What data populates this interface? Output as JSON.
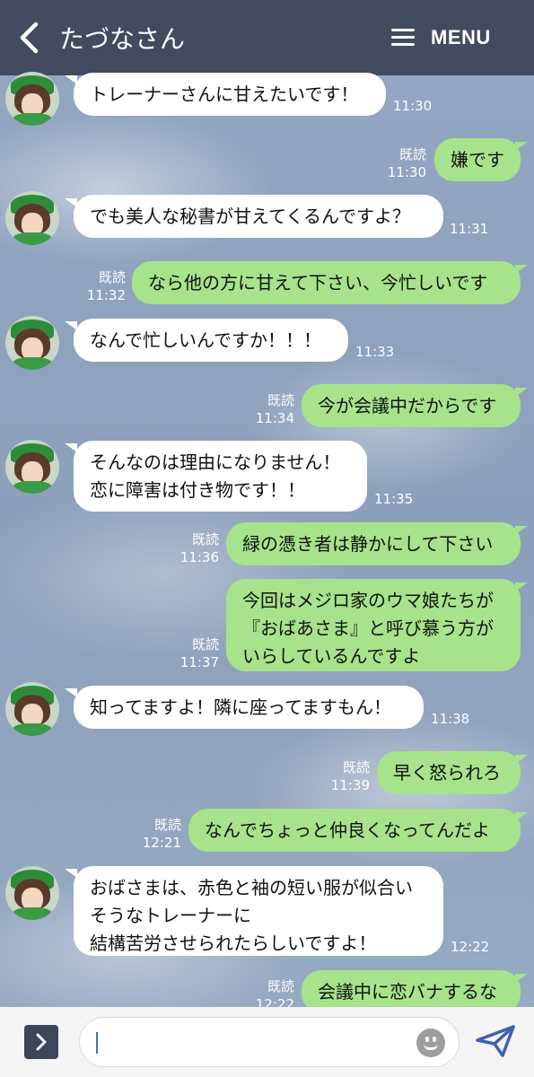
{
  "header": {
    "title": "たづなさん",
    "menu_label": "MENU"
  },
  "messages": [
    {
      "side": "left",
      "text": "トレーナーさんに甘えたいです！",
      "time": "11:30"
    },
    {
      "side": "right",
      "text": "嫌です",
      "read": "既読",
      "time": "11:30"
    },
    {
      "side": "left",
      "text": "でも美人な秘書が甘えてくるんですよ？",
      "time": "11:31"
    },
    {
      "side": "right",
      "text": "なら他の方に甘えて下さい、今忙しいです",
      "read": "既読",
      "time": "11:32"
    },
    {
      "side": "left",
      "text": "なんで忙しいんですか！！！",
      "time": "11:33"
    },
    {
      "side": "right",
      "text": "今が会議中だからです",
      "read": "既読",
      "time": "11:34"
    },
    {
      "side": "left",
      "text": "そんなのは理由になりません！\n恋に障害は付き物です！！",
      "time": "11:35"
    },
    {
      "side": "right",
      "text": "緑の憑き者は静かにして下さい",
      "read": "既読",
      "time": "11:36"
    },
    {
      "side": "right",
      "text": "今回はメジロ家のウマ娘たちが\n『おばあさま』と呼び慕う方が\nいらしているんですよ",
      "read": "既読",
      "time": "11:37"
    },
    {
      "side": "left",
      "text": "知ってますよ！隣に座ってますもん！",
      "time": "11:38"
    },
    {
      "side": "right",
      "text": "早く怒られろ",
      "read": "既読",
      "time": "11:39"
    },
    {
      "side": "right",
      "text": "なんでちょっと仲良くなってんだよ",
      "read": "既読",
      "time": "12:21"
    },
    {
      "side": "left",
      "text": "おばさまは、赤色と袖の短い服が似合い\nそうなトレーナーに\n結構苦労させられたらしいですよ！",
      "time": "12:22"
    },
    {
      "side": "right",
      "text": "会議中に恋バナするな",
      "read": "既読",
      "time": "12:22"
    }
  ],
  "composer": {
    "value": ""
  },
  "colors": {
    "header": "#434b60",
    "bubble_right": "#a6e38a",
    "bubble_left": "#ffffff"
  }
}
